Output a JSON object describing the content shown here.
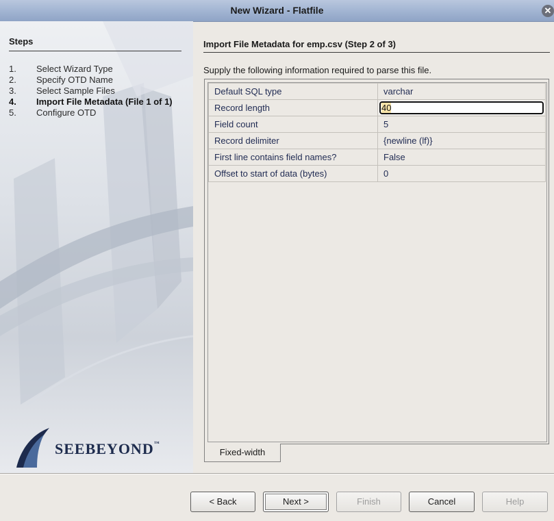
{
  "window": {
    "title": "New Wizard - Flatfile",
    "close_icon": "close-icon"
  },
  "steps": {
    "heading": "Steps",
    "items": [
      {
        "num": "1.",
        "label": "Select Wizard Type",
        "current": false
      },
      {
        "num": "2.",
        "label": "Specify OTD Name",
        "current": false
      },
      {
        "num": "3.",
        "label": "Select Sample Files",
        "current": false
      },
      {
        "num": "4.",
        "label": "Import File Metadata (File 1 of 1)",
        "current": true
      },
      {
        "num": "5.",
        "label": "Configure OTD",
        "current": false
      }
    ],
    "logo": "SeeBeyond"
  },
  "main": {
    "heading": "Import File Metadata for emp.csv (Step 2 of 3)",
    "instructions": "Supply the following information required to parse this file.",
    "properties": [
      {
        "key": "Default SQL type",
        "value": "varchar"
      },
      {
        "key": "Record length",
        "value": "40"
      },
      {
        "key": "Field count",
        "value": "5"
      },
      {
        "key": "Record delimiter",
        "value": "{newline (lf)}"
      },
      {
        "key": "First line contains field names?",
        "value": "False"
      },
      {
        "key": "Offset to start of data (bytes)",
        "value": "0"
      }
    ],
    "tab_label": "Fixed-width"
  },
  "buttons": {
    "back": "< Back",
    "next": "Next >",
    "finish": "Finish",
    "cancel": "Cancel",
    "help": "Help"
  },
  "colors": {
    "title_bar": "#a5b7d4",
    "selection": "#f5e3a5",
    "logo": "#1d2b4d"
  }
}
